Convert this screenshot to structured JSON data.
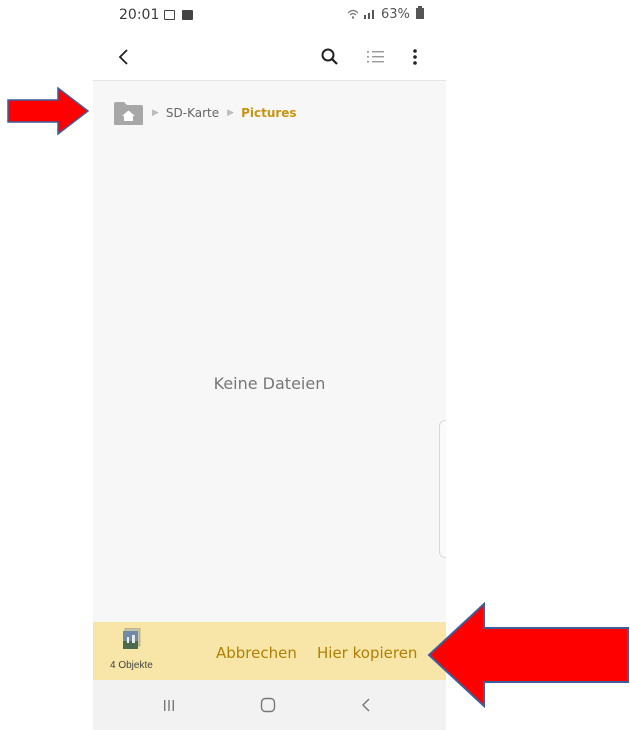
{
  "statusbar": {
    "time": "20:01",
    "battery_text": "63%"
  },
  "toolbar": {
    "icons": [
      "back-arrow-icon",
      "search-icon",
      "list-view-icon",
      "more-vert-icon"
    ]
  },
  "breadcrumb": {
    "items": [
      "SD-Karte",
      "Pictures"
    ]
  },
  "content": {
    "empty_message": "Keine Dateien"
  },
  "actionbar": {
    "object_count": "4 Objekte",
    "cancel_label": "Abbrechen",
    "copy_here_label": "Hier kopieren"
  },
  "navbar": {
    "icons": [
      "recent-apps-icon",
      "home-icon",
      "back-icon"
    ]
  },
  "colors": {
    "accent": "#c89512",
    "actionbar_bg": "#f7e6a7",
    "annotation_arrow": "#ff0000",
    "annotation_arrow_border": "#3f5d9a"
  }
}
